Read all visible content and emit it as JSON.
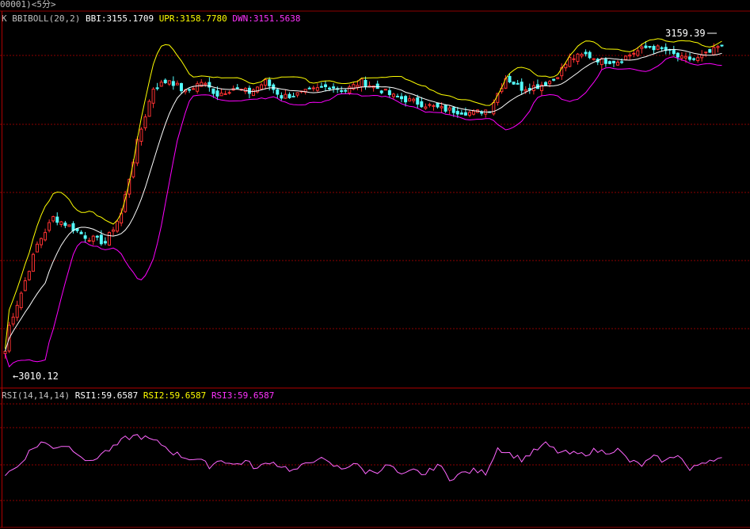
{
  "header": {
    "code_label": "00001)<5分>"
  },
  "main_legend": {
    "name": "K",
    "indicator": "BBIBOLL(20,2)",
    "bbi": "BBI:3155.1709",
    "upr": "UPR:3158.7780",
    "dwn": "DWN:3151.5638"
  },
  "rsi_legend": {
    "name": "RSI(14,14,14)",
    "rsi1": "RSI1:59.6587",
    "rsi2": "RSI2:59.6587",
    "rsi3": "RSI3:59.6587"
  },
  "annotations": {
    "high": "3159.39",
    "low": "←3010.12"
  },
  "colors": {
    "background": "#000000",
    "grid": "#8b0000",
    "up": "#ff3232",
    "down": "#54fcfc",
    "bbi": "#ffffff",
    "upr": "#ffff00",
    "dwn": "#ff00ff",
    "rsi": "#ff66ff"
  },
  "chart_data": [
    {
      "type": "candlestick",
      "ylim": [
        3005,
        3165
      ],
      "close_path": [
        [
          0,
          3019
        ],
        [
          4,
          3040
        ],
        [
          8,
          3063
        ],
        [
          12,
          3076
        ],
        [
          16,
          3072
        ],
        [
          20,
          3067
        ],
        [
          25,
          3064
        ],
        [
          29,
          3078
        ],
        [
          33,
          3112
        ],
        [
          37,
          3138
        ],
        [
          41,
          3142
        ],
        [
          45,
          3136
        ],
        [
          49,
          3141
        ],
        [
          53,
          3135
        ],
        [
          57,
          3138
        ],
        [
          61,
          3136
        ],
        [
          65,
          3141
        ],
        [
          69,
          3134
        ],
        [
          73,
          3135
        ],
        [
          77,
          3137
        ],
        [
          81,
          3139
        ],
        [
          85,
          3137
        ],
        [
          89,
          3141
        ],
        [
          93,
          3138
        ],
        [
          97,
          3134
        ],
        [
          101,
          3132
        ],
        [
          105,
          3130
        ],
        [
          109,
          3128
        ],
        [
          113,
          3127
        ],
        [
          117,
          3126
        ],
        [
          121,
          3128
        ],
        [
          125,
          3143
        ],
        [
          129,
          3138
        ],
        [
          133,
          3139
        ],
        [
          137,
          3142
        ],
        [
          141,
          3152
        ],
        [
          145,
          3154
        ],
        [
          149,
          3151
        ],
        [
          153,
          3151
        ],
        [
          157,
          3155
        ],
        [
          161,
          3158
        ],
        [
          165,
          3156
        ],
        [
          169,
          3152
        ],
        [
          173,
          3152
        ],
        [
          177,
          3156
        ],
        [
          179,
          3159
        ]
      ],
      "high": 3159.39,
      "low": 3010.12,
      "series": [
        {
          "name": "BBI",
          "value": 3155.1709
        },
        {
          "name": "UPR",
          "value": 3158.778
        },
        {
          "name": "DWN",
          "value": 3151.5638
        }
      ]
    },
    {
      "type": "line",
      "ylim": [
        0,
        100
      ],
      "rsi_path": [
        [
          0,
          34
        ],
        [
          3,
          42
        ],
        [
          6,
          58
        ],
        [
          9,
          68
        ],
        [
          12,
          63
        ],
        [
          15,
          65
        ],
        [
          18,
          58
        ],
        [
          21,
          46
        ],
        [
          24,
          56
        ],
        [
          27,
          62
        ],
        [
          30,
          72
        ],
        [
          33,
          75
        ],
        [
          36,
          71
        ],
        [
          39,
          66
        ],
        [
          42,
          57
        ],
        [
          45,
          52
        ],
        [
          48,
          50
        ],
        [
          51,
          43
        ],
        [
          54,
          50
        ],
        [
          57,
          44
        ],
        [
          60,
          48
        ],
        [
          63,
          40
        ],
        [
          66,
          48
        ],
        [
          69,
          43
        ],
        [
          72,
          38
        ],
        [
          75,
          44
        ],
        [
          78,
          52
        ],
        [
          81,
          45
        ],
        [
          84,
          40
        ],
        [
          87,
          46
        ],
        [
          90,
          37
        ],
        [
          93,
          38
        ],
        [
          96,
          44
        ],
        [
          99,
          32
        ],
        [
          102,
          38
        ],
        [
          105,
          34
        ],
        [
          108,
          45
        ],
        [
          111,
          30
        ],
        [
          114,
          35
        ],
        [
          117,
          38
        ],
        [
          120,
          36
        ],
        [
          123,
          62
        ],
        [
          126,
          56
        ],
        [
          129,
          50
        ],
        [
          132,
          58
        ],
        [
          135,
          66
        ],
        [
          138,
          58
        ],
        [
          141,
          56
        ],
        [
          144,
          55
        ],
        [
          147,
          59
        ],
        [
          150,
          58
        ],
        [
          153,
          60
        ],
        [
          156,
          48
        ],
        [
          159,
          44
        ],
        [
          162,
          52
        ],
        [
          165,
          48
        ],
        [
          168,
          56
        ],
        [
          171,
          38
        ],
        [
          174,
          47
        ],
        [
          177,
          51
        ],
        [
          179,
          50
        ]
      ],
      "rsi1": 59.6587,
      "rsi2": 59.6587,
      "rsi3": 59.6587
    }
  ]
}
